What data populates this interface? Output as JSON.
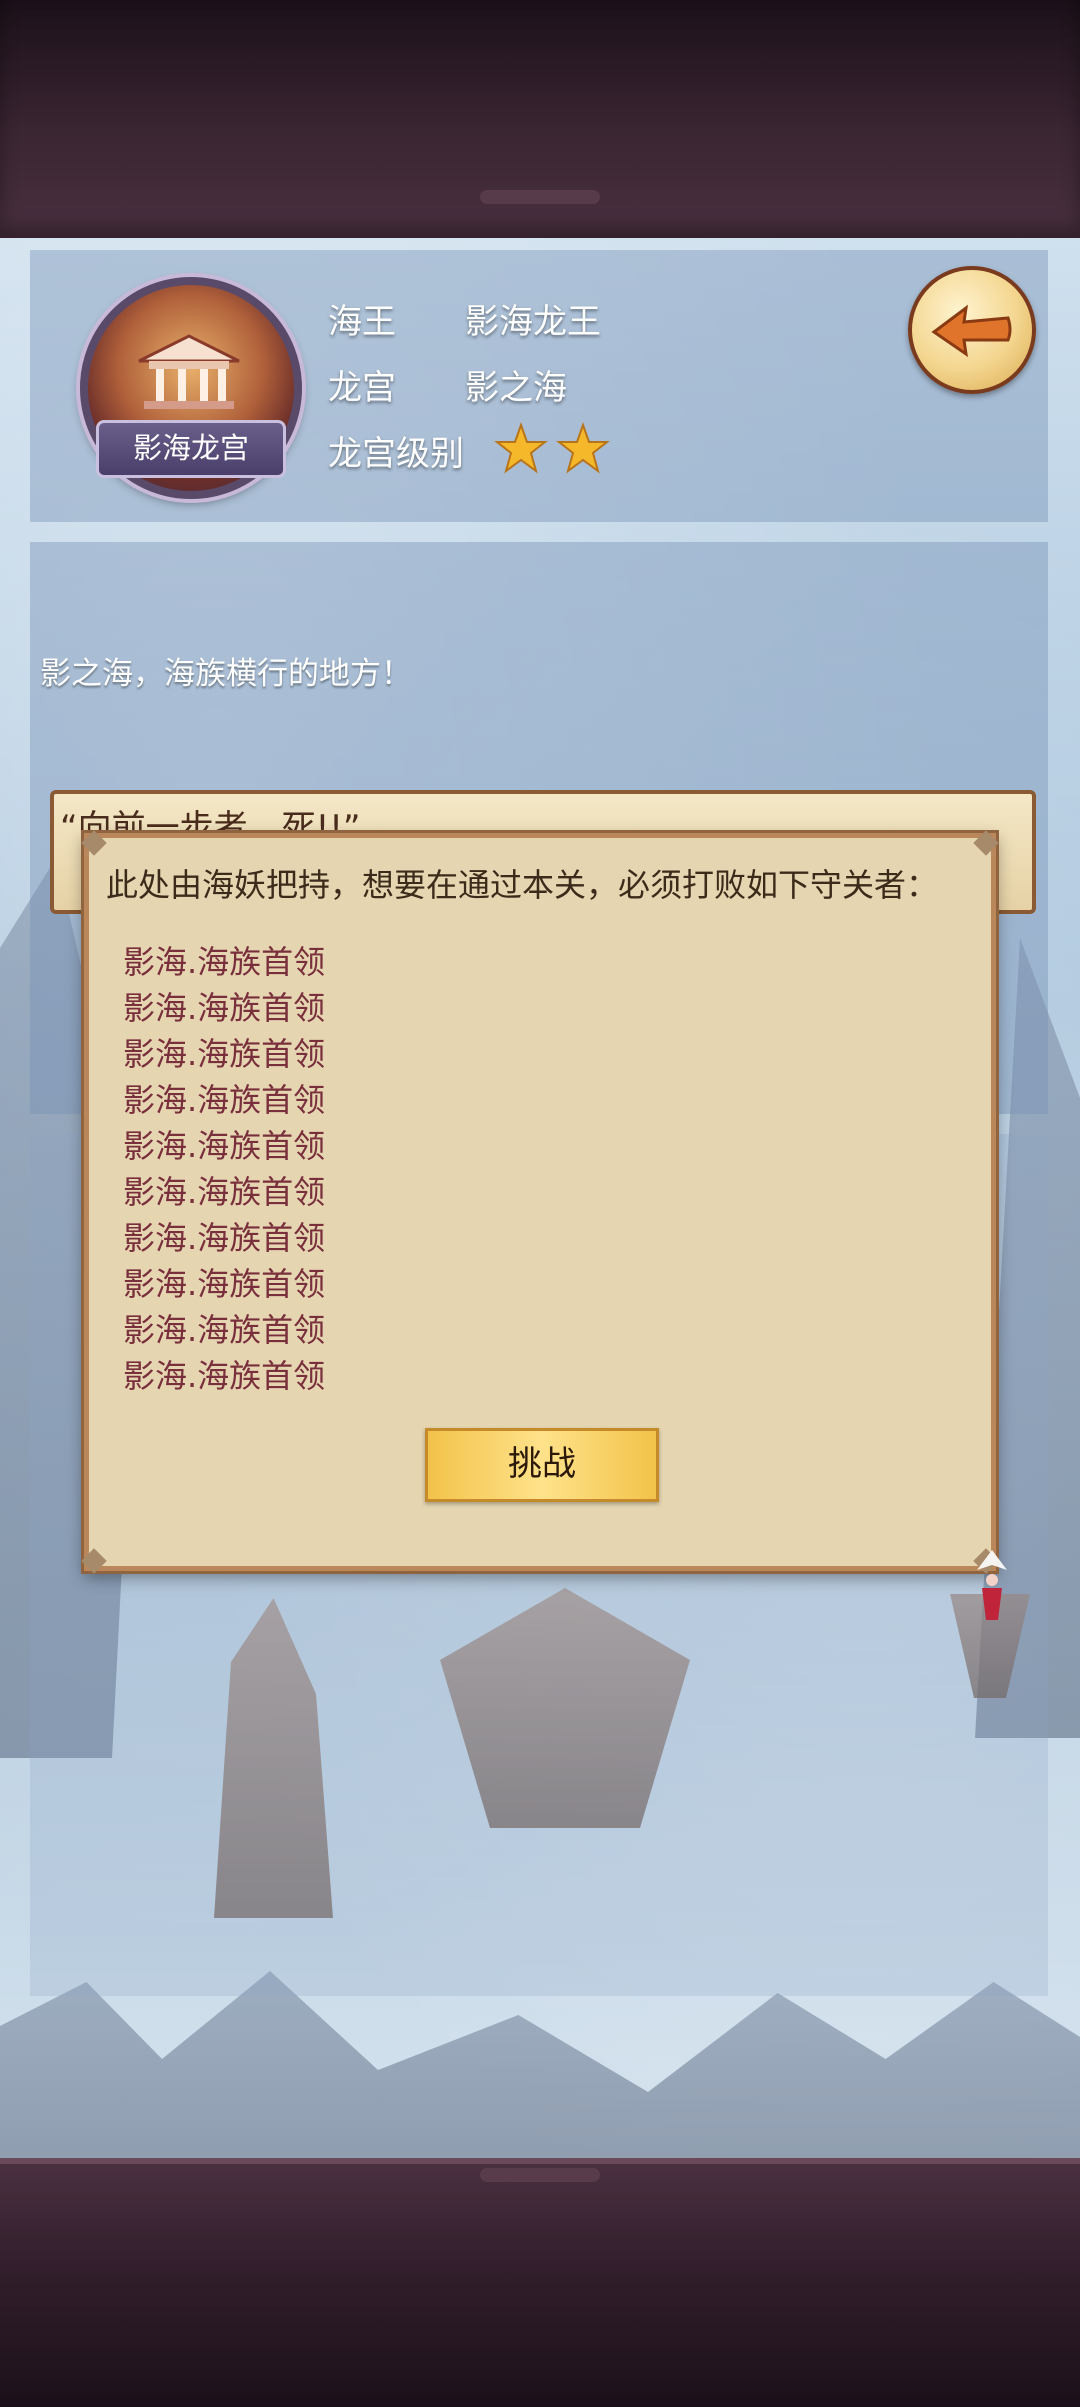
{
  "header": {
    "emblem_label": "影海龙宫",
    "row1_key": "海王",
    "row1_value": "影海龙王",
    "row2_key": "龙宫",
    "row2_value": "影之海",
    "row3_key": "龙宫级别",
    "star_rating": 2
  },
  "description": {
    "text": "影之海，海族横行的地方！",
    "quote": "“向前一步者，死!!”"
  },
  "dialog": {
    "title": "此处由海妖把持，想要在通过本关，必须打败如下守关者：",
    "guardians": [
      "影海.海族首领",
      "影海.海族首领",
      "影海.海族首领",
      "影海.海族首领",
      "影海.海族首领",
      "影海.海族首领",
      "影海.海族首领",
      "影海.海族首领",
      "影海.海族首领",
      "影海.海族首领"
    ],
    "challenge_label": "挑战"
  },
  "icons": {
    "back": "back-arrow-icon",
    "star": "star-icon"
  },
  "colors": {
    "dialog_bg": "#e5d6b1",
    "guardian_text": "#7a2f3d",
    "button_gold": "#f2c34a"
  }
}
